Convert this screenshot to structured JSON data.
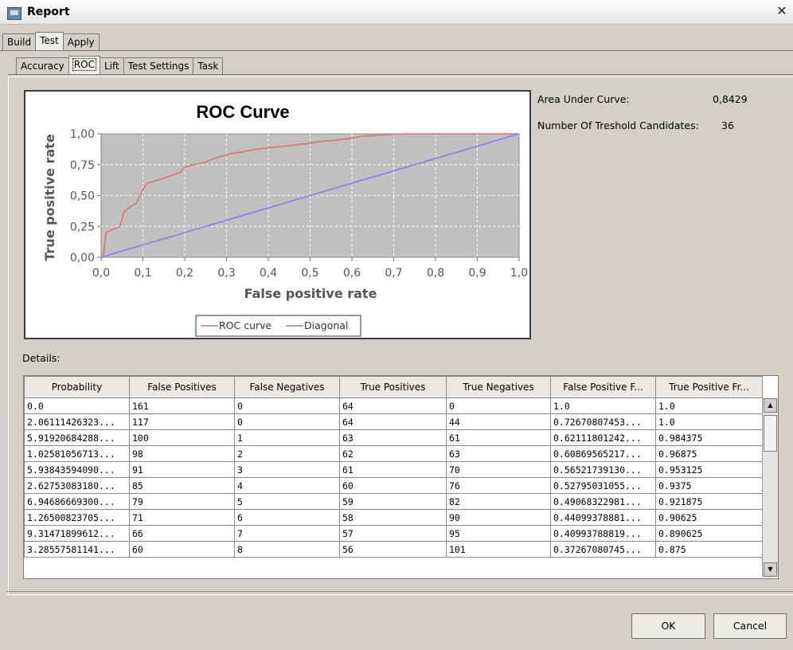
{
  "window": {
    "title": "Report",
    "close_glyph": "✕"
  },
  "tabs_main": [
    "Build",
    "Test",
    "Apply"
  ],
  "tabs_sub": [
    "Accuracy",
    "ROC",
    "Lift",
    "Test Settings",
    "Task"
  ],
  "info": {
    "auc_label": "Area Under Curve:",
    "auc_value": "0,8429",
    "thresholds_label": "Number Of Treshold Candidates:",
    "thresholds_value": "36"
  },
  "chart_data": {
    "type": "line",
    "title": "ROC Curve",
    "xlabel": "False positive rate",
    "ylabel": "True positive rate",
    "xlim": [
      0,
      1.0
    ],
    "ylim": [
      0,
      1.0
    ],
    "x_ticks": [
      "0,0",
      "0,1",
      "0,2",
      "0,3",
      "0,4",
      "0,5",
      "0,6",
      "0,7",
      "0,8",
      "0,9",
      "1,0"
    ],
    "y_ticks": [
      "0,00",
      "0,25",
      "0,50",
      "0,75",
      "1,00"
    ],
    "grid": true,
    "legend_position": "bottom",
    "series": [
      {
        "name": "ROC curve",
        "color": "#e0706f",
        "x": [
          0,
          0.006,
          0.012,
          0.025,
          0.045,
          0.055,
          0.07,
          0.085,
          0.1,
          0.11,
          0.15,
          0.19,
          0.2,
          0.22,
          0.25,
          0.27,
          0.29,
          0.31,
          0.33,
          0.37,
          0.409,
          0.44,
          0.49,
          0.528,
          0.565,
          0.609,
          0.621,
          0.727,
          1.0
        ],
        "y": [
          0,
          0.03,
          0.2,
          0.22,
          0.25,
          0.37,
          0.41,
          0.44,
          0.55,
          0.6,
          0.64,
          0.69,
          0.73,
          0.75,
          0.77,
          0.8,
          0.82,
          0.84,
          0.85,
          0.875,
          0.89,
          0.9,
          0.92,
          0.94,
          0.95,
          0.97,
          0.98,
          1.0,
          1.0
        ]
      },
      {
        "name": "Diagonal",
        "color": "#8080ee",
        "x": [
          0,
          1.0
        ],
        "y": [
          0,
          1.0
        ]
      }
    ]
  },
  "details": {
    "label": "Details:",
    "columns": [
      "Probability",
      "False Positives",
      "False Negatives",
      "True Positives",
      "True Negatives",
      "False Positive F...",
      "True Positive Fr..."
    ],
    "rows": [
      [
        "0.0",
        "161",
        "0",
        "64",
        "0",
        "1.0",
        "1.0"
      ],
      [
        "2.06111426323...",
        "117",
        "0",
        "64",
        "44",
        "0.72670807453...",
        "1.0"
      ],
      [
        "5.91920684288...",
        "100",
        "1",
        "63",
        "61",
        "0.62111801242...",
        "0.984375"
      ],
      [
        "1.02581056713...",
        "98",
        "2",
        "62",
        "63",
        "0.60869565217...",
        "0.96875"
      ],
      [
        "5.93843594090...",
        "91",
        "3",
        "61",
        "70",
        "0.56521739130...",
        "0.953125"
      ],
      [
        "2.62753083180...",
        "85",
        "4",
        "60",
        "76",
        "0.52795031055...",
        "0.9375"
      ],
      [
        "6.94686669300...",
        "79",
        "5",
        "59",
        "82",
        "0.49068322981...",
        "0.921875"
      ],
      [
        "1.26500823705...",
        "71",
        "6",
        "58",
        "90",
        "0.44099378881...",
        "0.90625"
      ],
      [
        "9.31471899612...",
        "66",
        "7",
        "57",
        "95",
        "0.40993788819...",
        "0.890625"
      ],
      [
        "3.28557581141...",
        "60",
        "8",
        "56",
        "101",
        "0.37267080745...",
        "0.875"
      ]
    ]
  },
  "buttons": {
    "ok": "OK",
    "cancel": "Cancel"
  }
}
